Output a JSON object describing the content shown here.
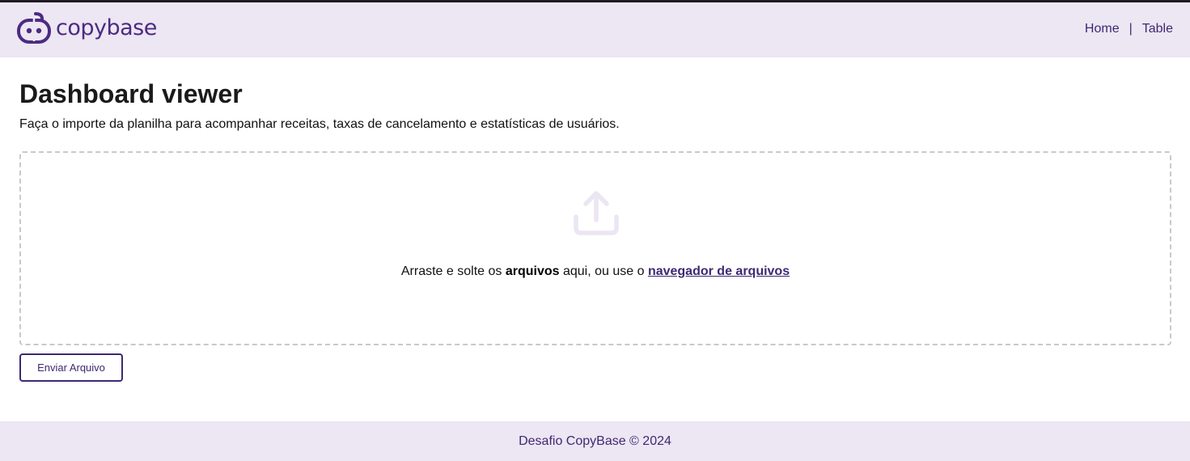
{
  "header": {
    "logo_text": "copybase",
    "nav": [
      {
        "label": "Home"
      },
      {
        "label": "Table"
      }
    ],
    "nav_separator": "|"
  },
  "main": {
    "title": "Dashboard viewer",
    "subtitle": "Faça o importe da planilha para acompanhar receitas, taxas de cancelamento e estatísticas de usuários.",
    "dropzone": {
      "icon": "upload-icon",
      "text_before": "Arraste e solte os ",
      "text_bold": "arquivos",
      "text_middle": " aqui, ou use o ",
      "link_label": "navegador de arquivos"
    },
    "send_button_label": "Enviar Arquivo"
  },
  "footer": {
    "text": "Desafio CopyBase © 2024"
  },
  "colors": {
    "brand": "#4b2b82",
    "header_bg": "#ede6f3",
    "link": "#3e2872"
  }
}
